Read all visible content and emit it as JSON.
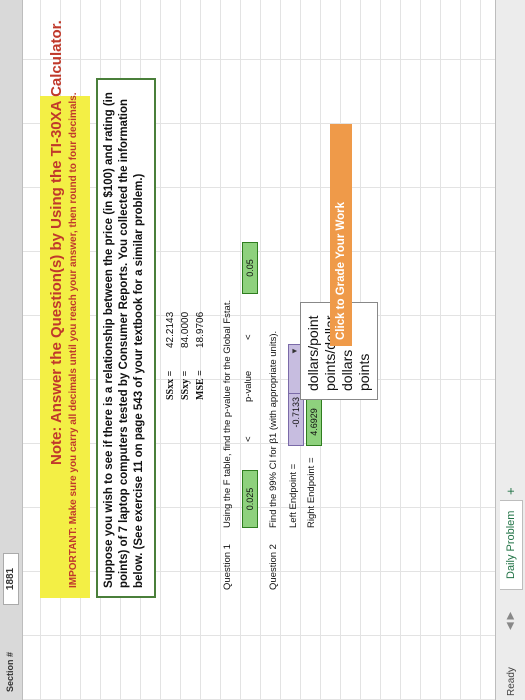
{
  "sheet": {
    "section_label": "Section #",
    "section_value": "1881"
  },
  "note": {
    "title": "Note: Answer the Question(s) by Using the TI-30XA Calculator.",
    "subtitle": "IMPORTANT: Make sure you carry all decimals until you reach your answer, then round to four decimals."
  },
  "problem": {
    "text": "Suppose you wish to see if there is a relationship between the price (in $100) and rating (in points) of 7 laptop computers tested by Consumer Reports. You collected the information below. (See exercise 11 on page 543 of your textbook for a similar problem.)"
  },
  "stats": [
    {
      "label": "SSxx =",
      "value": "42.2143"
    },
    {
      "label": "SSxy =",
      "value": "84.0000"
    },
    {
      "label": "MSE =",
      "value": "18.9706"
    }
  ],
  "question1": {
    "label": "Question 1",
    "prompt": "Using the F table, find the p-value for the Global Fstat.",
    "lower": "0.025",
    "lt1": "<",
    "pvalue": "p-value",
    "lt2": "<",
    "upper": "0.05"
  },
  "question2": {
    "label": "Question 2",
    "prompt": "Find the 99% CI for β1 (with appropriate units).",
    "left_label": "Left Endpoint =",
    "left_value": "-0.7133",
    "right_label": "Right Endpoint =",
    "right_value": "4.6929",
    "dropdown_arrow": "▼",
    "unit_options": [
      "dollars/point",
      "points/dollar",
      "dollars",
      "points"
    ]
  },
  "grade_button": "Click to Grade Your Work",
  "statusbar": {
    "status": "Ready",
    "nav": "◀ ▶",
    "tab": "Daily Problem",
    "add": "+"
  },
  "colors": {
    "note_bg": "#f3ef45",
    "note_text": "#c0392b",
    "answer_green": "#8ed17d",
    "answer_purple": "#c7bde0",
    "grade_orange": "#ef9a49"
  }
}
